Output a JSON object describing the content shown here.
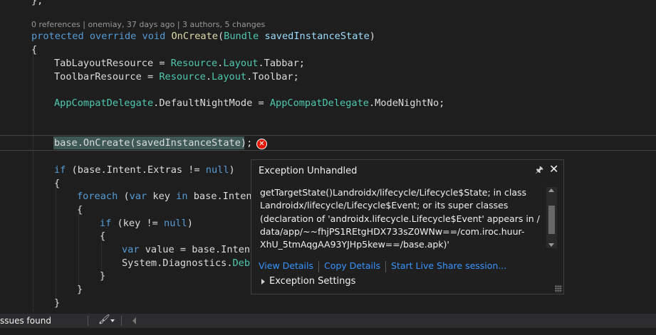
{
  "editor": {
    "top_brace_fragment": "};",
    "codelens": "0 references | onemiay, 37 days ago | 3 authors, 5 changes",
    "method_signature": {
      "kw1": "protected",
      "kw2": "override",
      "kw3": "void",
      "name": "OnCreate",
      "open_paren": "(",
      "param_type": "Bundle",
      "param_name": "savedInstanceState",
      "close_paren": ")"
    },
    "open_brace": "{",
    "line_tablayout": {
      "lhs": "TabLayoutResource = ",
      "res": "Resource",
      "dot1": ".",
      "layout": "Layout",
      "dot2": ".",
      "val": "Tabbar",
      "end": ";"
    },
    "line_toolbar": {
      "lhs": "ToolbarResource = ",
      "res": "Resource",
      "dot1": ".",
      "layout": "Layout",
      "dot2": ".",
      "val": "Toolbar",
      "end": ";"
    },
    "line_nightmode": {
      "cls1": "AppCompatDelegate",
      "mid": ".DefaultNightMode = ",
      "cls2": "AppCompatDelegate",
      "end": ".ModeNightNo;"
    },
    "current_line": "base.OnCreate(savedInstanceState);",
    "if_line": {
      "kw": "if",
      "rest": " (base.Intent.Extras != ",
      "null": "null",
      "end": ")"
    },
    "brace2": "{",
    "foreach_line": {
      "kw": "foreach",
      "p1": " (",
      "var": "var",
      "p2": " key ",
      "in": "in",
      "p3": " base.Intent"
    },
    "brace3": "{",
    "ifkey_line": {
      "kw": "if",
      "p1": " (key != ",
      "null": "null",
      "end": ")"
    },
    "brace4": "{",
    "var_line": {
      "kw": "var",
      "rest": " value = base.Intent"
    },
    "sysdiag_line": {
      "a": "System.Diagnostics.",
      "b": "Debu"
    },
    "close4": "}",
    "close3": "}",
    "close2": "}"
  },
  "exception_popup": {
    "title": "Exception Unhandled",
    "pin_icon": "pin-icon",
    "close_icon": "close-icon",
    "message_lines": [
      "getTargetState()Landroidx/lifecycle/Lifecycle$State; in class",
      "Landroidx/lifecycle/Lifecycle$Event; or its super classes",
      "(declaration of 'androidx.lifecycle.Lifecycle$Event' appears in /",
      "data/app/~~fhjPS1REtgHDX733sZ0WNw==/com.iroc.huur-",
      "XhU_5tmAqgAA93YJHp5kew==/base.apk)'"
    ],
    "link_view_details": "View Details",
    "link_copy_details": "Copy Details",
    "link_live_share": "Start Live Share session...",
    "exception_settings": "Exception Settings"
  },
  "status_bar": {
    "issues_text": "ssues found",
    "cleanup_icon": "brush-icon"
  },
  "colors": {
    "error": "#e51400",
    "link": "#3794ff",
    "keyword": "#569cd6",
    "type": "#4ec9b0"
  }
}
